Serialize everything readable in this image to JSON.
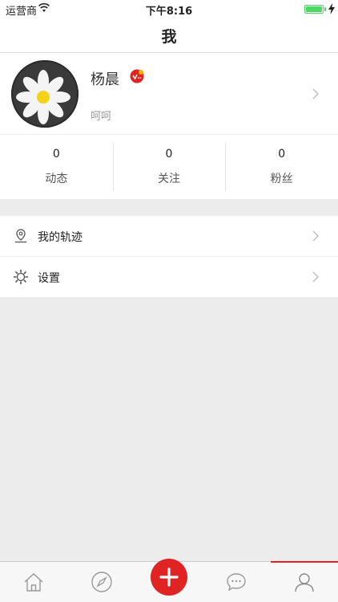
{
  "status_bar": {
    "carrier": "运营商",
    "time": "下午8:16"
  },
  "nav": {
    "title": "我"
  },
  "profile": {
    "name": "杨晨",
    "signature": "呵呵"
  },
  "stats": [
    {
      "count": "0",
      "label": "动态"
    },
    {
      "count": "0",
      "label": "关注"
    },
    {
      "count": "0",
      "label": "粉丝"
    }
  ],
  "menu": [
    {
      "label": "我的轨迹",
      "icon": "location-pin-icon"
    },
    {
      "label": "设置",
      "icon": "gear-icon"
    }
  ],
  "tab_bar": {
    "tabs": [
      "home-icon",
      "compass-icon",
      "compose-plus-icon",
      "chat-bubble-icon",
      "user-icon"
    ],
    "active_index": 4
  },
  "colors": {
    "accent": "#e02424",
    "battery": "#4cd964",
    "background": "#ececec"
  }
}
